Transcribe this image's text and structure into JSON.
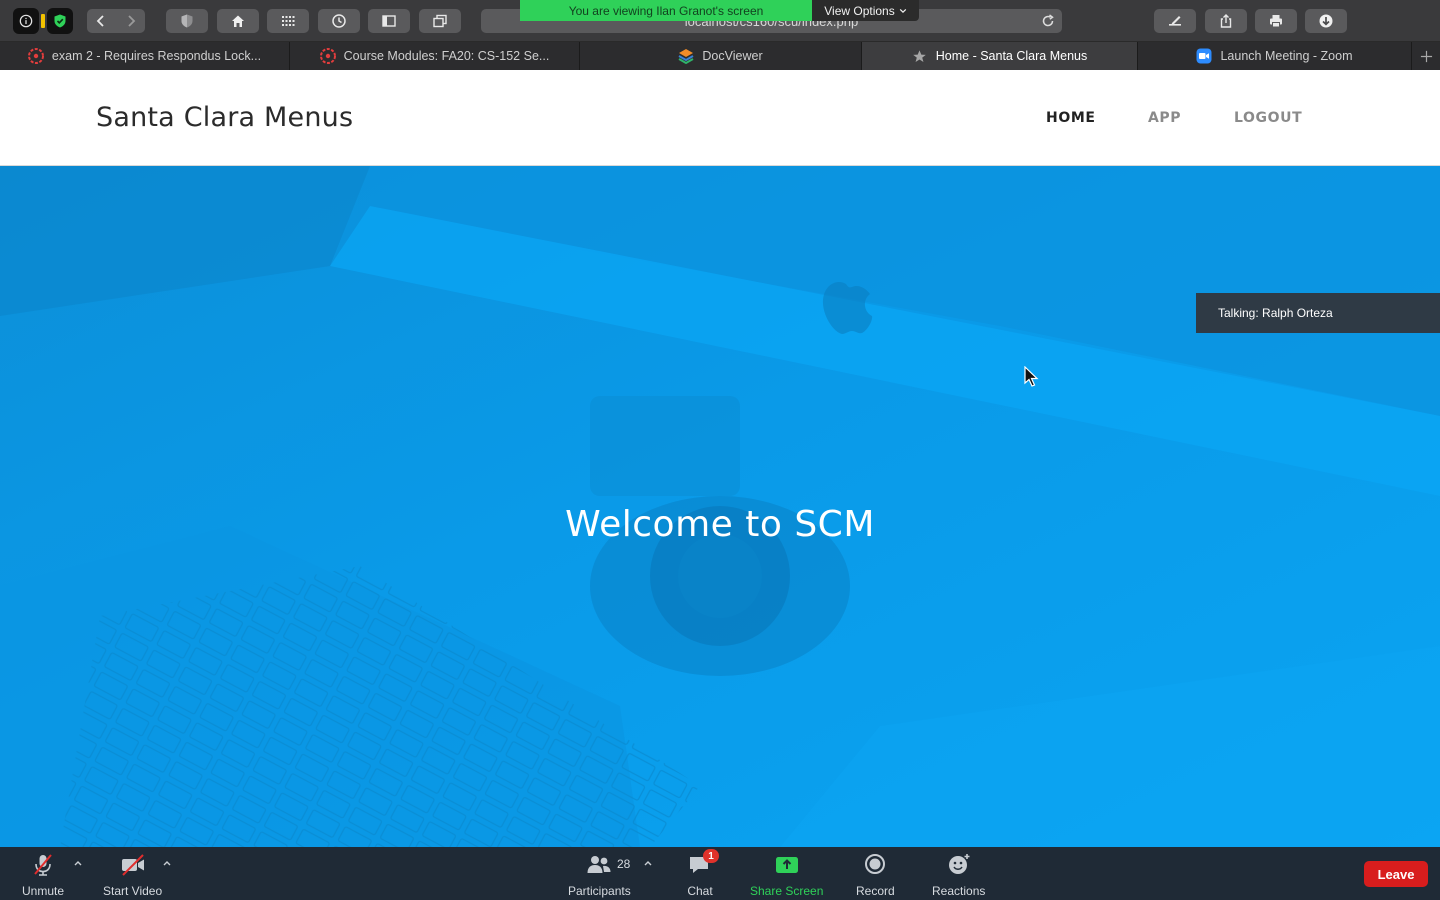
{
  "browser": {
    "url": "localhost/cs160/scu/index.php",
    "share_banner": "You are viewing Ilan Granot's screen",
    "view_options": "View Options",
    "tabs": [
      {
        "label": "exam 2 - Requires Respondus Lock...",
        "icon": "canvas-icon",
        "active": false
      },
      {
        "label": "Course Modules: FA20: CS-152 Se...",
        "icon": "canvas-icon",
        "active": false
      },
      {
        "label": "DocViewer",
        "icon": "docviewer-icon",
        "active": false
      },
      {
        "label": "Home - Santa Clara Menus",
        "icon": "star-icon",
        "active": true
      },
      {
        "label": "Launch Meeting - Zoom",
        "icon": "zoom-icon",
        "active": false
      }
    ]
  },
  "site": {
    "brand": "Santa Clara Menus",
    "nav": [
      {
        "label": "HOME",
        "current": true
      },
      {
        "label": "APP",
        "current": false
      },
      {
        "label": "LOGOUT",
        "current": false
      }
    ],
    "hero_title": "Welcome to SCM",
    "hero_color": "#0aa0ee"
  },
  "zoom": {
    "talking": "Talking: Ralph Orteza",
    "unmute": "Unmute",
    "start_video": "Start Video",
    "participants": "Participants",
    "participants_count": "28",
    "chat": "Chat",
    "chat_badge": "1",
    "share_screen": "Share Screen",
    "record": "Record",
    "reactions": "Reactions",
    "leave": "Leave",
    "share_color": "#2fd159",
    "leave_color": "#d81d1d"
  }
}
